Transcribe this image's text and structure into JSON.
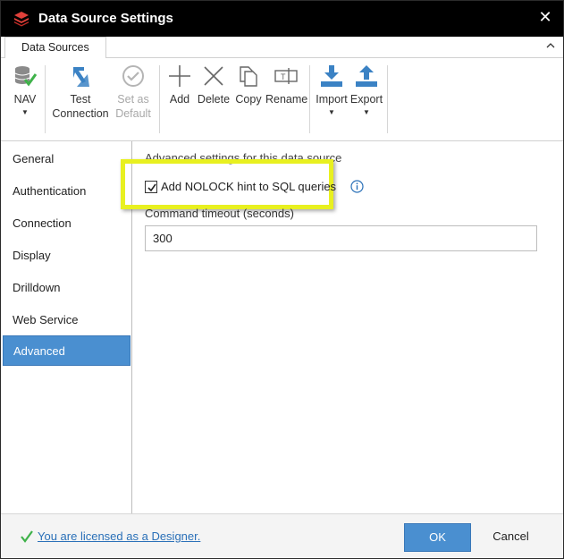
{
  "window": {
    "title": "Data Source Settings",
    "close_glyph": "✕"
  },
  "tabs": [
    {
      "label": "Data Sources"
    }
  ],
  "ribbon": {
    "nav": {
      "label": "NAV",
      "caret": "▼"
    },
    "test": {
      "label1": "Test",
      "label2": "Connection"
    },
    "default": {
      "label1": "Set as",
      "label2": "Default"
    },
    "add": {
      "label": "Add"
    },
    "delete": {
      "label": "Delete"
    },
    "copy": {
      "label": "Copy"
    },
    "rename": {
      "label": "Rename"
    },
    "import": {
      "label": "Import",
      "caret": "▼"
    },
    "export": {
      "label": "Export",
      "caret": "▼"
    }
  },
  "sidebar": {
    "items": [
      {
        "label": "General"
      },
      {
        "label": "Authentication"
      },
      {
        "label": "Connection"
      },
      {
        "label": "Display"
      },
      {
        "label": "Drilldown"
      },
      {
        "label": "Web Service"
      },
      {
        "label": "Advanced",
        "active": true
      }
    ]
  },
  "content": {
    "section_title": "Advanced settings for this data source",
    "nolock": {
      "label": "Add NOLOCK hint to SQL queries",
      "checked": true
    },
    "timeout": {
      "label": "Command timeout (seconds)",
      "value": "300"
    }
  },
  "footer": {
    "license_text": "You are licensed as a Designer.",
    "ok_label": "OK",
    "cancel_label": "Cancel"
  },
  "colors": {
    "accent": "#4a8fd0",
    "highlight": "#e8f020",
    "titlebar": "#000000"
  }
}
